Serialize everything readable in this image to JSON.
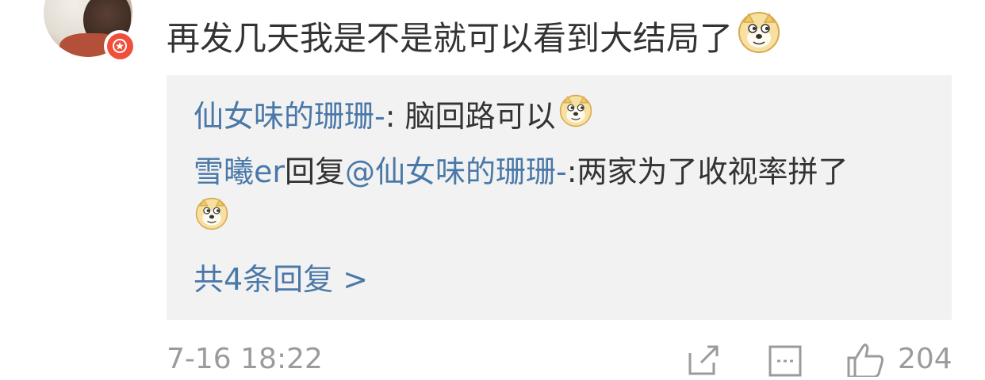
{
  "comment": {
    "text": "再发几天我是不是就可以看到大结局了",
    "emoji": "doge-icon"
  },
  "replies": [
    {
      "author": "仙女味的珊珊-",
      "separator": ": ",
      "text": "脑回路可以",
      "emoji": "doge-icon"
    },
    {
      "author": "雪曦er",
      "reply_word": "回复",
      "mention": "@仙女味的珊珊-",
      "text": ":两家为了收视率拼了",
      "emoji": "doge-icon"
    }
  ],
  "more_replies": "共4条回复 >",
  "footer": {
    "timestamp": "7-16 18:22",
    "like_count": "204"
  },
  "colors": {
    "link": "#4a78a8",
    "text": "#333333",
    "muted": "#9b9b9b",
    "reply_bg": "#f2f2f2",
    "badge": "#ef4f3b"
  }
}
